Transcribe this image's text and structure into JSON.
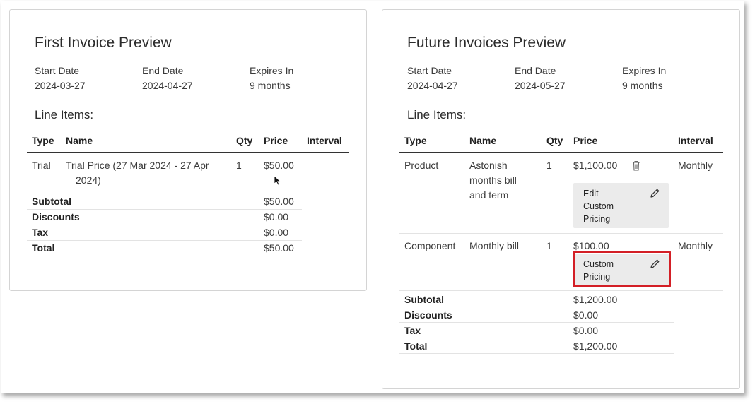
{
  "first_invoice": {
    "title": "First Invoice Preview",
    "meta": [
      {
        "label": "Start Date",
        "value": "2024-03-27"
      },
      {
        "label": "End Date",
        "value": "2024-04-27"
      },
      {
        "label": "Expires In",
        "value": "9 months"
      }
    ],
    "line_items_title": "Line Items:",
    "columns": {
      "type": "Type",
      "name": "Name",
      "qty": "Qty",
      "price": "Price",
      "interval": "Interval"
    },
    "rows": [
      {
        "type": "Trial",
        "name_line1": "Trial Price (27 Mar 2024 - 27 Apr",
        "name_line2": "2024)",
        "qty": "1",
        "price": "$50.00",
        "interval": ""
      }
    ],
    "summary": [
      {
        "label": "Subtotal",
        "value": "$50.00"
      },
      {
        "label": "Discounts",
        "value": "$0.00"
      },
      {
        "label": "Tax",
        "value": "$0.00"
      },
      {
        "label": "Total",
        "value": "$50.00"
      }
    ]
  },
  "future_invoices": {
    "title": "Future Invoices Preview",
    "meta": [
      {
        "label": "Start Date",
        "value": "2024-04-27"
      },
      {
        "label": "End Date",
        "value": "2024-05-27"
      },
      {
        "label": "Expires In",
        "value": "9 months"
      }
    ],
    "line_items_title": "Line Items:",
    "columns": {
      "type": "Type",
      "name": "Name",
      "qty": "Qty",
      "price": "Price",
      "interval": "Interval"
    },
    "rows": [
      {
        "type": "Product",
        "name_lines": [
          "Astonish",
          "months bill",
          "and term"
        ],
        "qty": "1",
        "price": "$1,100.00",
        "interval": "Monthly",
        "button_lines": [
          "Edit",
          "Custom",
          "Pricing"
        ],
        "button_icon": "pencil-icon",
        "delete_icon": "trash-icon"
      },
      {
        "type": "Component",
        "name_lines": [
          "Monthly bill"
        ],
        "qty": "1",
        "price": "$100.00",
        "interval": "Monthly",
        "button_lines": [
          "Custom",
          "Pricing"
        ],
        "button_icon": "pencil-icon",
        "highlight_color": "#d31f26"
      }
    ],
    "summary": [
      {
        "label": "Subtotal",
        "value": "$1,200.00"
      },
      {
        "label": "Discounts",
        "value": "$0.00"
      },
      {
        "label": "Tax",
        "value": "$0.00"
      },
      {
        "label": "Total",
        "value": "$1,200.00"
      }
    ]
  }
}
